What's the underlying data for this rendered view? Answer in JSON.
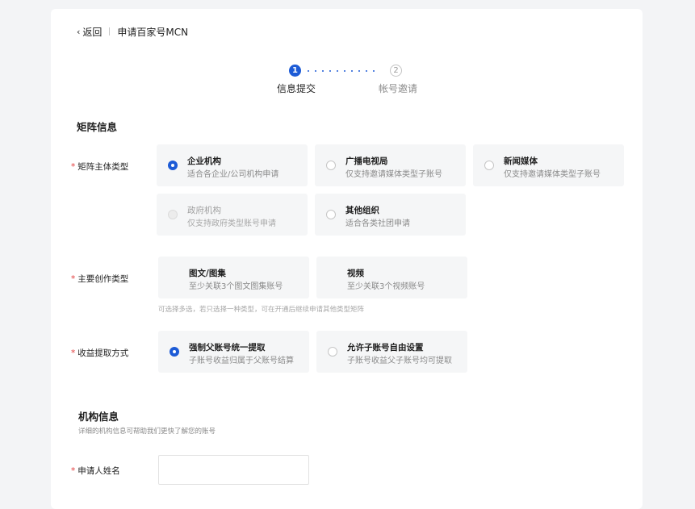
{
  "header": {
    "back_label": "返回",
    "title": "申请百家号MCN"
  },
  "stepper": {
    "steps": [
      {
        "number": "1",
        "label": "信息提交",
        "active": true
      },
      {
        "number": "2",
        "label": "帐号邀请",
        "active": false
      }
    ]
  },
  "matrix_section": {
    "title": "矩阵信息",
    "entity_type": {
      "label": "矩阵主体类型",
      "options": [
        {
          "title": "企业机构",
          "desc": "适合各企业/公司机构申请",
          "selected": true,
          "disabled": false
        },
        {
          "title": "广播电视局",
          "desc": "仅支持邀请媒体类型子账号",
          "selected": false,
          "disabled": false
        },
        {
          "title": "新闻媒体",
          "desc": "仅支持邀请媒体类型子账号",
          "selected": false,
          "disabled": false
        },
        {
          "title": "政府机构",
          "desc": "仅支持政府类型账号申请",
          "selected": false,
          "disabled": true
        },
        {
          "title": "其他组织",
          "desc": "适合各类社团申请",
          "selected": false,
          "disabled": false
        }
      ]
    },
    "creation_type": {
      "label": "主要创作类型",
      "options": [
        {
          "title": "图文/图集",
          "desc": "至少关联3个图文图集账号"
        },
        {
          "title": "视频",
          "desc": "至少关联3个视频账号"
        }
      ],
      "hint": "可选择多选，若只选择一种类型，可在开通后继续申请其他类型矩阵"
    },
    "withdraw_method": {
      "label": "收益提取方式",
      "options": [
        {
          "title": "强制父账号统一提取",
          "desc": "子账号收益归属于父账号结算",
          "selected": true
        },
        {
          "title": "允许子账号自由设置",
          "desc": "子账号收益父子账号均可提取",
          "selected": false
        }
      ]
    }
  },
  "org_section": {
    "title": "机构信息",
    "subtitle": "详细的机构信息可帮助我们更快了解您的账号",
    "applicant_name": {
      "label": "申请人姓名",
      "value": "",
      "placeholder": ""
    }
  },
  "colors": {
    "accent": "#1d5bd6",
    "required": "#e23c3c",
    "option_bg": "#f5f6f7",
    "page_bg": "#f3f4f6"
  }
}
